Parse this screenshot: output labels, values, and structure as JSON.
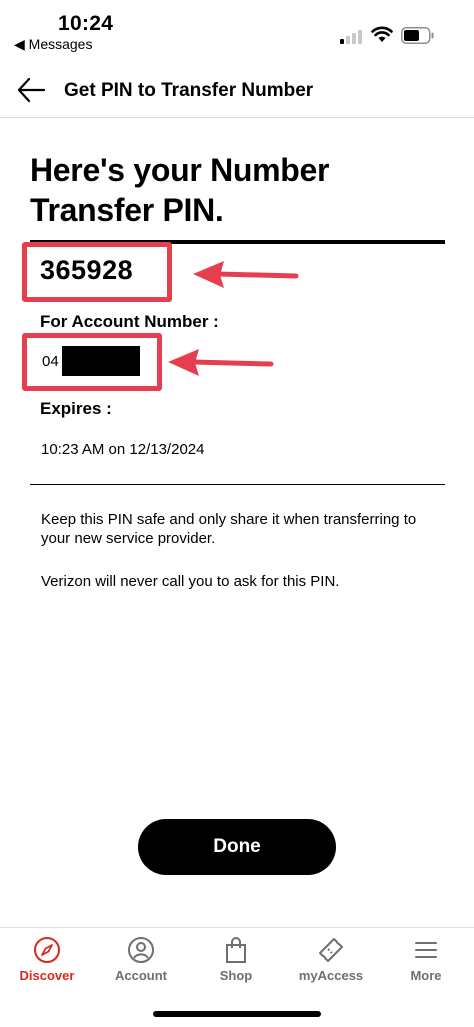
{
  "status_bar": {
    "time": "10:24",
    "back_app": "◀ Messages"
  },
  "header": {
    "title": "Get PIN to Transfer Number"
  },
  "main": {
    "title": "Here's your Number Transfer PIN.",
    "pin": "365928",
    "account_label": "For Account Number :",
    "account_prefix": "04",
    "expires_label": "Expires :",
    "expires_value": "10:23 AM on 12/13/2024",
    "info_1": "Keep this PIN safe and only share it when transferring to your new service provider.",
    "info_2": "Verizon will never call you to ask for this PIN.",
    "done_label": "Done"
  },
  "tabs": [
    {
      "label": "Discover",
      "icon": "compass-icon",
      "active": true
    },
    {
      "label": "Account",
      "icon": "person-icon",
      "active": false
    },
    {
      "label": "Shop",
      "icon": "shopping-bag-icon",
      "active": false
    },
    {
      "label": "myAccess",
      "icon": "ticket-icon",
      "active": false
    },
    {
      "label": "More",
      "icon": "menu-icon",
      "active": false
    }
  ],
  "colors": {
    "accent": "#d52b1e",
    "annotation": "#e53e4f",
    "tab_inactive": "#6f6f6f"
  }
}
